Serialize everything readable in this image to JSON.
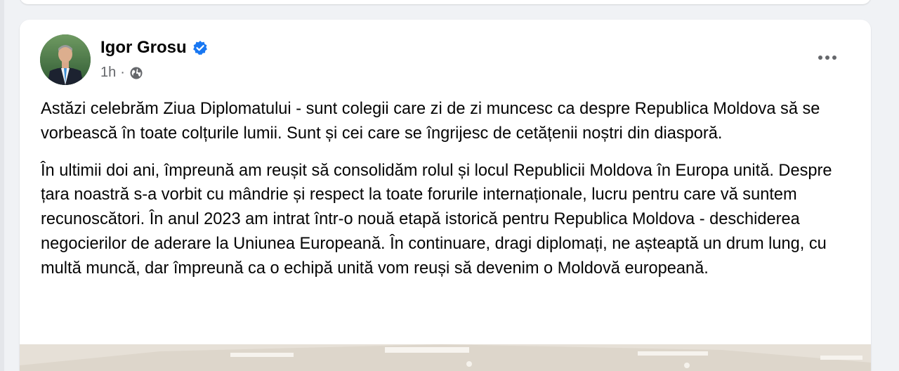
{
  "post": {
    "author": "Igor Grosu",
    "time": "1h",
    "separator": "·",
    "paragraphs": [
      "Astăzi celebrăm Ziua Diplomatului - sunt colegii care zi de zi muncesc ca despre Republica Moldova să se vorbească în toate colțurile lumii. Sunt și cei care se îngrijesc de cetățenii noștri din diasporă.",
      "În ultimii doi ani, împreună am reușit să consolidăm rolul și locul Republicii Moldova în Europa unită. Despre țara noastră s-a vorbit cu mândrie și respect la toate forurile internaționale, lucru pentru care vă suntem recunoscători. În anul 2023 am intrat într-o nouă etapă istorică pentru Republica Moldova - deschiderea negocierilor de aderare la Uniunea Europeană. În continuare, dragi diplomați, ne așteaptă un drum lung, cu multă muncă, dar împreună ca o echipă unită vom reuși să devenim o Moldovă europeană."
    ]
  },
  "icons": {
    "verified": "verified-badge-icon",
    "audience": "globe-icon",
    "more": "more-options-icon"
  },
  "colors": {
    "verified": "#1877f2",
    "background": "#f0f2f5",
    "secondary_text": "#65676b"
  }
}
